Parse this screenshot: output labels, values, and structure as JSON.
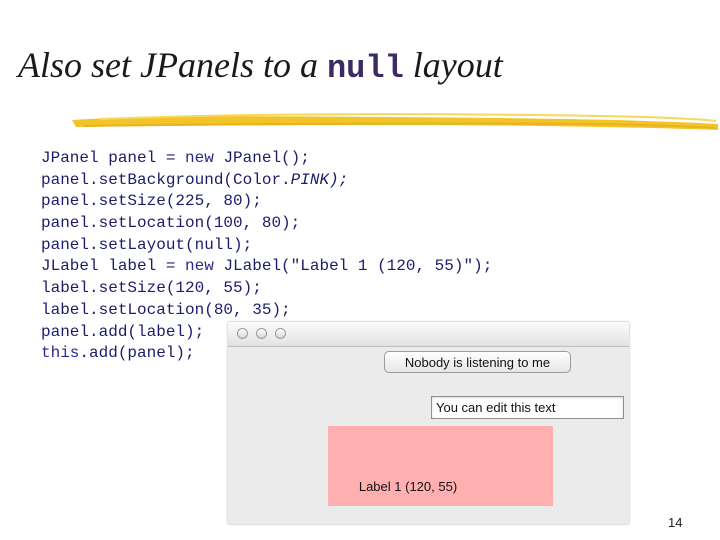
{
  "slide": {
    "title_prefix": "Also set JPanels to a ",
    "title_code": "null",
    "title_suffix": " layout",
    "page_number": "14"
  },
  "code_lines": [
    {
      "a": "JPanel panel = ",
      "kw": "new",
      "b": " JPanel();"
    },
    {
      "a": "panel.setBackground(Color.",
      "it": "PINK);"
    },
    {
      "a": "panel.setSize(225, 80);"
    },
    {
      "a": "panel.setLocation(100, 80);"
    },
    {
      "a": "panel.setLayout(null);"
    },
    {
      "a": "JLabel label = ",
      "kw": "new",
      "b": " JLabel(\"Label 1 (120, 55)\");"
    },
    {
      "a": "label.setSize(120, 55);"
    },
    {
      "a": "label.setLocation(80, 35);"
    },
    {
      "a": "panel.add(label);"
    },
    {
      "kw": "this",
      "b": ".add(panel);"
    }
  ],
  "window": {
    "traffic_lights": [
      "close",
      "minimize",
      "zoom"
    ],
    "button_label": "Nobody is listening to me",
    "textfield_value": "You can edit this text",
    "panel_label": "Label 1 (120, 55)",
    "panel_color": "#ffafaf"
  }
}
